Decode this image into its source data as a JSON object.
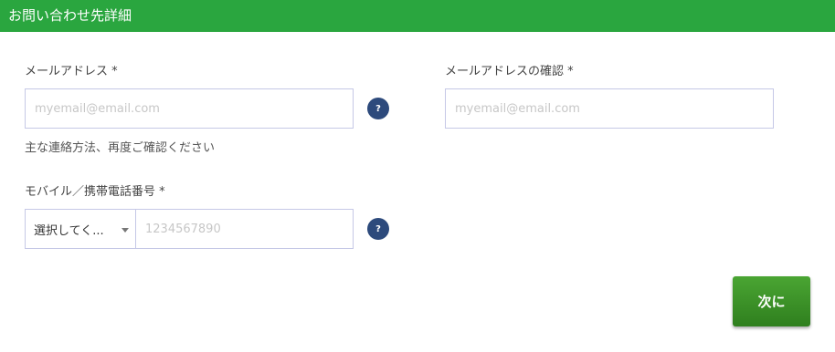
{
  "header": {
    "title": "お問い合わせ先詳細"
  },
  "email": {
    "label": "メールアドレス *",
    "placeholder": "myemail@email.com",
    "value": "",
    "hint": "主な連絡方法、再度ご確認ください"
  },
  "email_confirm": {
    "label": "メールアドレスの確認 *",
    "placeholder": "myemail@email.com",
    "value": ""
  },
  "mobile": {
    "label": "モバイル／携帯電話番号 *",
    "country_select": "選択してく...",
    "placeholder": "1234567890",
    "value": ""
  },
  "help_icon": {
    "glyph": "?"
  },
  "next_button": {
    "label": "次に"
  },
  "colors": {
    "header_bg": "#2aa63f",
    "help_bg": "#2d4a7c",
    "button_bg": "#3a9128",
    "input_border": "#c5c8e6"
  }
}
